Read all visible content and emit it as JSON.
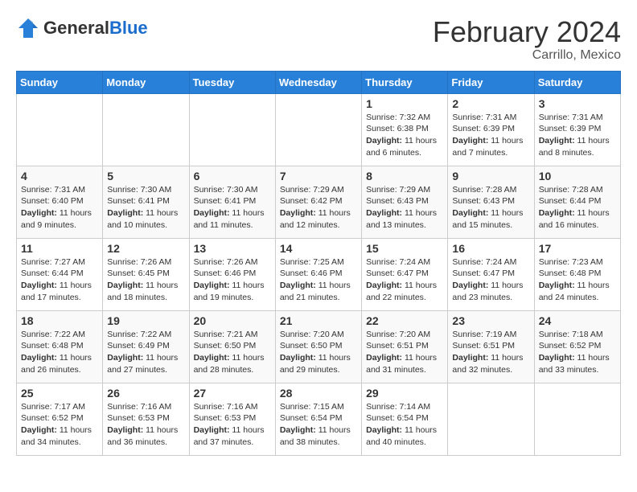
{
  "header": {
    "logo_general": "General",
    "logo_blue": "Blue",
    "title": "February 2024",
    "subtitle": "Carrillo, Mexico"
  },
  "days_of_week": [
    "Sunday",
    "Monday",
    "Tuesday",
    "Wednesday",
    "Thursday",
    "Friday",
    "Saturday"
  ],
  "weeks": [
    [
      {
        "day": "",
        "info": ""
      },
      {
        "day": "",
        "info": ""
      },
      {
        "day": "",
        "info": ""
      },
      {
        "day": "",
        "info": ""
      },
      {
        "day": "1",
        "info": "Sunrise: 7:32 AM\nSunset: 6:38 PM\nDaylight: 11 hours and 6 minutes."
      },
      {
        "day": "2",
        "info": "Sunrise: 7:31 AM\nSunset: 6:39 PM\nDaylight: 11 hours and 7 minutes."
      },
      {
        "day": "3",
        "info": "Sunrise: 7:31 AM\nSunset: 6:39 PM\nDaylight: 11 hours and 8 minutes."
      }
    ],
    [
      {
        "day": "4",
        "info": "Sunrise: 7:31 AM\nSunset: 6:40 PM\nDaylight: 11 hours and 9 minutes."
      },
      {
        "day": "5",
        "info": "Sunrise: 7:30 AM\nSunset: 6:41 PM\nDaylight: 11 hours and 10 minutes."
      },
      {
        "day": "6",
        "info": "Sunrise: 7:30 AM\nSunset: 6:41 PM\nDaylight: 11 hours and 11 minutes."
      },
      {
        "day": "7",
        "info": "Sunrise: 7:29 AM\nSunset: 6:42 PM\nDaylight: 11 hours and 12 minutes."
      },
      {
        "day": "8",
        "info": "Sunrise: 7:29 AM\nSunset: 6:43 PM\nDaylight: 11 hours and 13 minutes."
      },
      {
        "day": "9",
        "info": "Sunrise: 7:28 AM\nSunset: 6:43 PM\nDaylight: 11 hours and 15 minutes."
      },
      {
        "day": "10",
        "info": "Sunrise: 7:28 AM\nSunset: 6:44 PM\nDaylight: 11 hours and 16 minutes."
      }
    ],
    [
      {
        "day": "11",
        "info": "Sunrise: 7:27 AM\nSunset: 6:44 PM\nDaylight: 11 hours and 17 minutes."
      },
      {
        "day": "12",
        "info": "Sunrise: 7:26 AM\nSunset: 6:45 PM\nDaylight: 11 hours and 18 minutes."
      },
      {
        "day": "13",
        "info": "Sunrise: 7:26 AM\nSunset: 6:46 PM\nDaylight: 11 hours and 19 minutes."
      },
      {
        "day": "14",
        "info": "Sunrise: 7:25 AM\nSunset: 6:46 PM\nDaylight: 11 hours and 21 minutes."
      },
      {
        "day": "15",
        "info": "Sunrise: 7:24 AM\nSunset: 6:47 PM\nDaylight: 11 hours and 22 minutes."
      },
      {
        "day": "16",
        "info": "Sunrise: 7:24 AM\nSunset: 6:47 PM\nDaylight: 11 hours and 23 minutes."
      },
      {
        "day": "17",
        "info": "Sunrise: 7:23 AM\nSunset: 6:48 PM\nDaylight: 11 hours and 24 minutes."
      }
    ],
    [
      {
        "day": "18",
        "info": "Sunrise: 7:22 AM\nSunset: 6:48 PM\nDaylight: 11 hours and 26 minutes."
      },
      {
        "day": "19",
        "info": "Sunrise: 7:22 AM\nSunset: 6:49 PM\nDaylight: 11 hours and 27 minutes."
      },
      {
        "day": "20",
        "info": "Sunrise: 7:21 AM\nSunset: 6:50 PM\nDaylight: 11 hours and 28 minutes."
      },
      {
        "day": "21",
        "info": "Sunrise: 7:20 AM\nSunset: 6:50 PM\nDaylight: 11 hours and 29 minutes."
      },
      {
        "day": "22",
        "info": "Sunrise: 7:20 AM\nSunset: 6:51 PM\nDaylight: 11 hours and 31 minutes."
      },
      {
        "day": "23",
        "info": "Sunrise: 7:19 AM\nSunset: 6:51 PM\nDaylight: 11 hours and 32 minutes."
      },
      {
        "day": "24",
        "info": "Sunrise: 7:18 AM\nSunset: 6:52 PM\nDaylight: 11 hours and 33 minutes."
      }
    ],
    [
      {
        "day": "25",
        "info": "Sunrise: 7:17 AM\nSunset: 6:52 PM\nDaylight: 11 hours and 34 minutes."
      },
      {
        "day": "26",
        "info": "Sunrise: 7:16 AM\nSunset: 6:53 PM\nDaylight: 11 hours and 36 minutes."
      },
      {
        "day": "27",
        "info": "Sunrise: 7:16 AM\nSunset: 6:53 PM\nDaylight: 11 hours and 37 minutes."
      },
      {
        "day": "28",
        "info": "Sunrise: 7:15 AM\nSunset: 6:54 PM\nDaylight: 11 hours and 38 minutes."
      },
      {
        "day": "29",
        "info": "Sunrise: 7:14 AM\nSunset: 6:54 PM\nDaylight: 11 hours and 40 minutes."
      },
      {
        "day": "",
        "info": ""
      },
      {
        "day": "",
        "info": ""
      }
    ]
  ]
}
